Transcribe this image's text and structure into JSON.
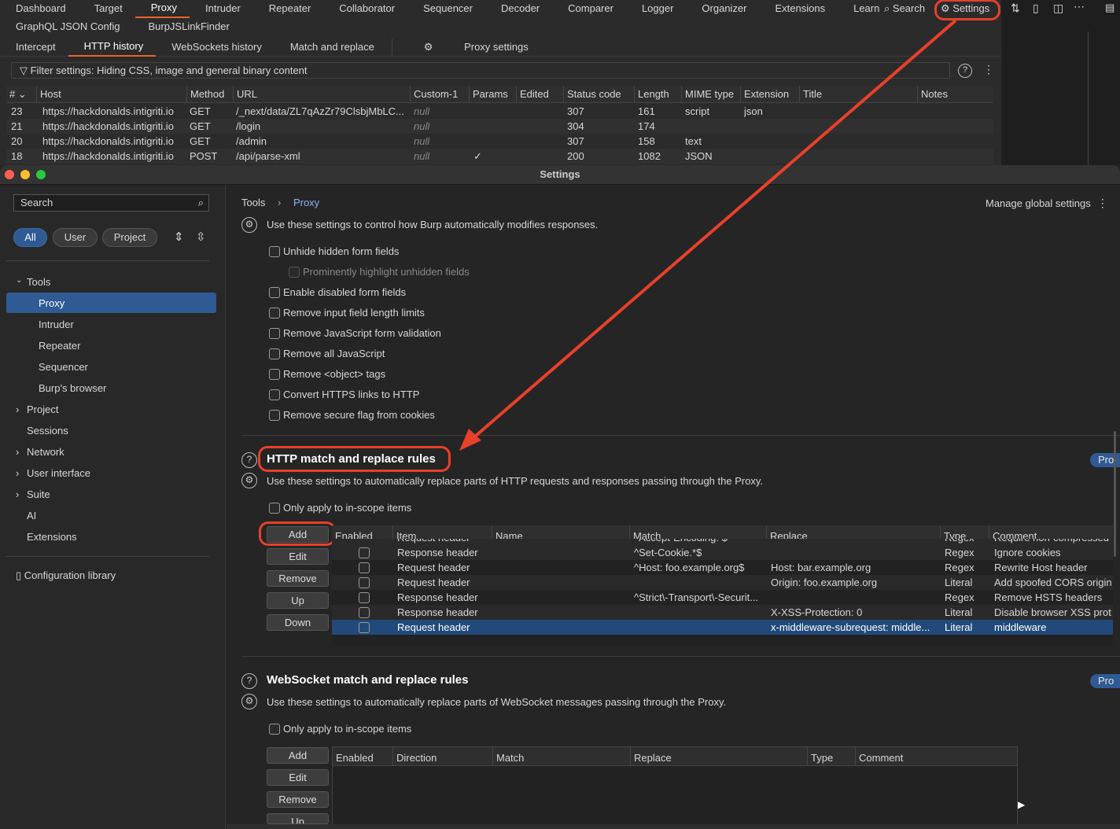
{
  "topnav": [
    "Dashboard",
    "Target",
    "Proxy",
    "Intruder",
    "Repeater",
    "Collaborator",
    "Sequencer",
    "Decoder",
    "Comparer",
    "Logger",
    "Organizer",
    "Extensions",
    "Learn"
  ],
  "topnav_search": "Search",
  "topnav_settings": "Settings",
  "row2": [
    "GraphQL JSON Config",
    "BurpJSLinkFinder"
  ],
  "subtabs": [
    "Intercept",
    "HTTP history",
    "WebSockets history",
    "Match and replace"
  ],
  "proxy_settings": "Proxy settings",
  "filter": "Filter settings: Hiding CSS, image and general binary content",
  "history_cols": [
    "# ⌄",
    "Host",
    "Method",
    "URL",
    "Custom-1",
    "Params",
    "Edited",
    "Status code",
    "Length",
    "MIME type",
    "Extension",
    "Title",
    "Notes"
  ],
  "history_rows": [
    {
      "n": "23",
      "host": "https://hackdonalds.intigriti.io",
      "method": "GET",
      "url": "/_next/data/ZL7qAzZr79ClsbjMbLC...",
      "custom": "null",
      "params": "",
      "status": "307",
      "length": "161",
      "mime": "script",
      "ext": "json"
    },
    {
      "n": "21",
      "host": "https://hackdonalds.intigriti.io",
      "method": "GET",
      "url": "/login",
      "custom": "null",
      "params": "",
      "status": "304",
      "length": "174",
      "mime": "",
      "ext": ""
    },
    {
      "n": "20",
      "host": "https://hackdonalds.intigriti.io",
      "method": "GET",
      "url": "/admin",
      "custom": "null",
      "params": "",
      "status": "307",
      "length": "158",
      "mime": "text",
      "ext": ""
    },
    {
      "n": "18",
      "host": "https://hackdonalds.intigriti.io",
      "method": "POST",
      "url": "/api/parse-xml",
      "custom": "null",
      "params": "✓",
      "status": "200",
      "length": "1082",
      "mime": "JSON",
      "ext": ""
    }
  ],
  "window_title": "Settings",
  "sidebar": {
    "search": "Search",
    "filters": [
      "All",
      "User",
      "Project"
    ],
    "tools": "Tools",
    "tool_items": [
      "Proxy",
      "Intruder",
      "Repeater",
      "Sequencer",
      "Burp's browser"
    ],
    "sections": [
      "Project",
      "Sessions",
      "Network",
      "User interface",
      "Suite",
      "AI",
      "Extensions"
    ],
    "config": "Configuration library"
  },
  "breadcrumb": {
    "root": "Tools",
    "current": "Proxy"
  },
  "manage_global": "Manage global settings",
  "response_mod": {
    "desc": "Use these settings to control how Burp automatically modifies responses.",
    "options": [
      "Unhide hidden form fields",
      "Prominently highlight unhidden fields",
      "Enable disabled form fields",
      "Remove input field length limits",
      "Remove JavaScript form validation",
      "Remove all JavaScript",
      "Remove <object> tags",
      "Convert HTTPS links to HTTP",
      "Remove secure flag from cookies"
    ]
  },
  "http_rules": {
    "title": "HTTP match and replace rules",
    "desc": "Use these settings to automatically replace parts of HTTP requests and responses passing through the Proxy.",
    "scope": "Only apply to in-scope items",
    "buttons": [
      "Add",
      "Edit",
      "Remove",
      "Up",
      "Down"
    ],
    "cols": [
      "Enabled",
      "Item",
      "Name",
      "Match",
      "Replace",
      "Type",
      "Comment"
    ],
    "rows": [
      {
        "item": "Request header",
        "match": "^Accept-Encoding: $",
        "replace": "",
        "type": "Regex",
        "comment": "Require non-compressed"
      },
      {
        "item": "Response header",
        "match": "^Set-Cookie.*$",
        "replace": "",
        "type": "Regex",
        "comment": "Ignore cookies"
      },
      {
        "item": "Request header",
        "match": "^Host: foo.example.org$",
        "replace": "Host: bar.example.org",
        "type": "Regex",
        "comment": "Rewrite Host header"
      },
      {
        "item": "Request header",
        "match": "",
        "replace": "Origin: foo.example.org",
        "type": "Literal",
        "comment": "Add spoofed CORS origin"
      },
      {
        "item": "Response header",
        "match": "^Strict\\-Transport\\-Securit...",
        "replace": "",
        "type": "Regex",
        "comment": "Remove HSTS headers"
      },
      {
        "item": "Response header",
        "match": "",
        "replace": "X-XSS-Protection: 0",
        "type": "Literal",
        "comment": "Disable browser XSS prot"
      },
      {
        "item": "Request header",
        "match": "",
        "replace": "x-middleware-subrequest: middle...",
        "type": "Literal",
        "comment": "middleware"
      }
    ],
    "pro": "Pro"
  },
  "ws_rules": {
    "title": "WebSocket match and replace rules",
    "desc": "Use these settings to automatically replace parts of WebSocket messages passing through the Proxy.",
    "scope": "Only apply to in-scope items",
    "buttons": [
      "Add",
      "Edit",
      "Remove",
      "Up"
    ],
    "cols": [
      "Enabled",
      "Direction",
      "Match",
      "Replace",
      "Type",
      "Comment"
    ],
    "pro": "Pro"
  }
}
